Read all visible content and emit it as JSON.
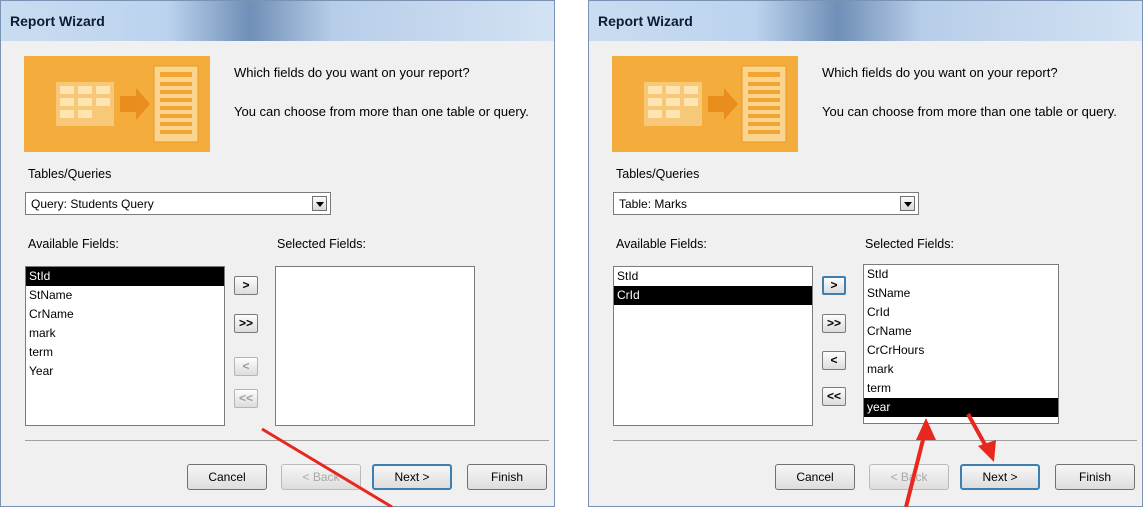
{
  "accent_colors": {
    "wizard_image": "#f4ac3c",
    "arrow": "#e8281e",
    "selection": "#000000"
  },
  "left": {
    "title": "Report Wizard",
    "prompt1": "Which fields do you want on your report?",
    "prompt2": "You can choose from more than one table or query.",
    "tables_label": "Tables/Queries",
    "tables_value": "Query: Students Query",
    "available_label": "Available Fields:",
    "selected_label": "Selected Fields:",
    "available_fields": [
      "StId",
      "StName",
      "CrName",
      "mark",
      "term",
      "Year"
    ],
    "available_selected_index": 0,
    "selected_fields": [],
    "selected_selected_index": -1,
    "move": {
      "one": ">",
      "all": ">>",
      "back_one": "<",
      "back_all": "<<"
    },
    "buttons": {
      "cancel": "Cancel",
      "back": "< Back",
      "next": "Next >",
      "finish": "Finish"
    }
  },
  "right": {
    "title": "Report Wizard",
    "prompt1": "Which fields do you want on your report?",
    "prompt2": "You can choose from more than one table or query.",
    "tables_label": "Tables/Queries",
    "tables_value": "Table: Marks",
    "available_label": "Available Fields:",
    "selected_label": "Selected Fields:",
    "available_fields": [
      "StId",
      "CrId"
    ],
    "available_selected_index": 1,
    "selected_fields": [
      "StId",
      "StName",
      "CrId",
      "CrName",
      "CrCrHours",
      "mark",
      "term",
      "year"
    ],
    "selected_selected_index": 7,
    "move": {
      "one": ">",
      "all": ">>",
      "back_one": "<",
      "back_all": "<<"
    },
    "buttons": {
      "cancel": "Cancel",
      "back": "< Back",
      "next": "Next >",
      "finish": "Finish"
    }
  }
}
